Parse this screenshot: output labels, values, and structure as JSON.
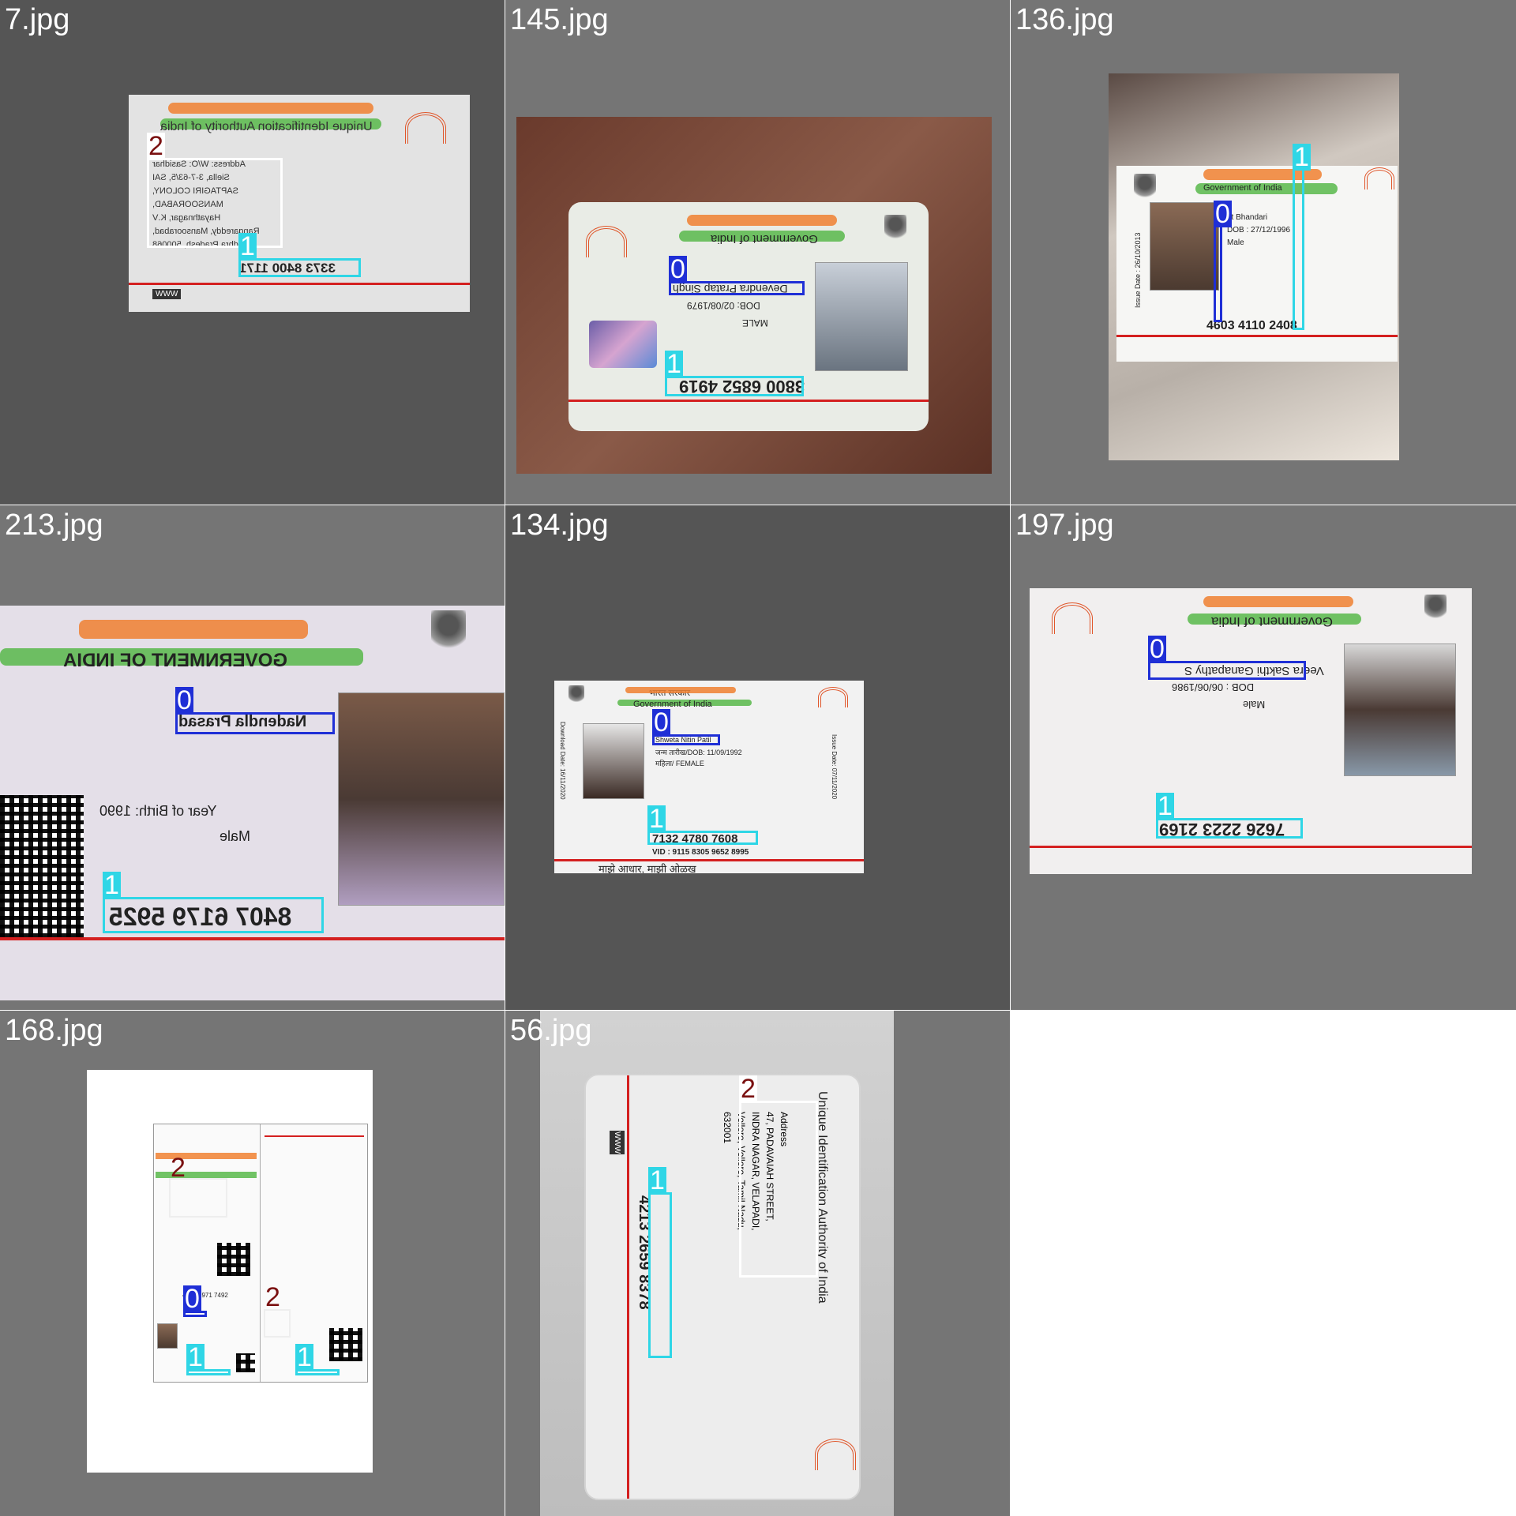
{
  "tiles": [
    {
      "label": "7.jpg",
      "lines": {
        "uidai": "Unique Identification Authority of India",
        "addr_1": "Address: W/O: Sasidhar",
        "addr_2": "Siella, 3-7-63/5, SAI",
        "addr_3": "SAPTAGIRI COLONY,",
        "addr_4": "MANSOORABAD,",
        "addr_5": "Hayathnagar, K.V",
        "addr_6": "Rangareddy, Mansoorabad,",
        "addr_7": "Andhra Pradesh, 500068",
        "number": "3373 8400 1171",
        "www": "WWW"
      },
      "boxes": [
        {
          "cls": "2"
        },
        {
          "cls": "1"
        }
      ]
    },
    {
      "label": "145.jpg",
      "lines": {
        "gov": "Government of India",
        "name": "Devendra Pratap Singh",
        "dob": "DOB: 02/08/1979",
        "gender": "MALE",
        "number": "3800 6852 4919"
      },
      "boxes": [
        {
          "cls": "0"
        },
        {
          "cls": "1"
        }
      ]
    },
    {
      "label": "136.jpg",
      "lines": {
        "gov": "Government of India",
        "issue": "Issue Date : 26/10/2013",
        "name": "nt Bhandari",
        "dob": "DOB : 27/12/1996",
        "gender": "Male",
        "number": "4603 4110 2408"
      },
      "boxes": [
        {
          "cls": "0"
        },
        {
          "cls": "1"
        }
      ]
    },
    {
      "label": "213.jpg",
      "lines": {
        "gov": "GOVERNMENT OF INDIA",
        "name": "Nadendla Prasad",
        "yob": "Year of Birth: 1990",
        "gender": "Male",
        "number": "8407 6179 5925"
      },
      "boxes": [
        {
          "cls": "0"
        },
        {
          "cls": "1"
        }
      ]
    },
    {
      "label": "134.jpg",
      "lines": {
        "sarkar": "भारत सरकार",
        "gov": "Government of India",
        "name": "Shweta Nitin Patil",
        "dob": "जन्म तारीख/DOB: 11/09/1992",
        "gender": "महिला/ FEMALE",
        "download": "Download Date: 16/11/2020",
        "issue": "Issue Date: 07/11/2020",
        "number": "7132 4780 7608",
        "vid": "VID : 9115 8305 9652 8995",
        "slogan": "माझे आधार, माझी ओळख"
      },
      "boxes": [
        {
          "cls": "0"
        },
        {
          "cls": "1"
        }
      ]
    },
    {
      "label": "197.jpg",
      "lines": {
        "gov": "Government of India",
        "name": "Veera Sakthi Ganapathy S",
        "dob": "DOB : 06/06/1986",
        "gender": "Male",
        "number": "7626 2223 2169"
      },
      "boxes": [
        {
          "cls": "0"
        },
        {
          "cls": "1"
        }
      ]
    },
    {
      "label": "168.jpg",
      "lines": {
        "number": "4586 1971 7492"
      },
      "boxes": [
        {
          "cls": "2"
        },
        {
          "cls": "0"
        },
        {
          "cls": "1"
        },
        {
          "cls": "2"
        },
        {
          "cls": "1"
        }
      ]
    },
    {
      "label": "56.jpg",
      "lines": {
        "uidai": "Unique Identification Authority of India",
        "addr_1": "Address",
        "addr_2": "47, PADAVAIAH STREET,",
        "addr_3": "INDRA NAGAR, VELAPADI,",
        "addr_4": "Vellore, Vellore, Tamil Nadu,",
        "addr_5": "632001",
        "number": "4213 2659 8378",
        "www": "WWW"
      },
      "boxes": [
        {
          "cls": "2"
        },
        {
          "cls": "1"
        }
      ]
    }
  ]
}
